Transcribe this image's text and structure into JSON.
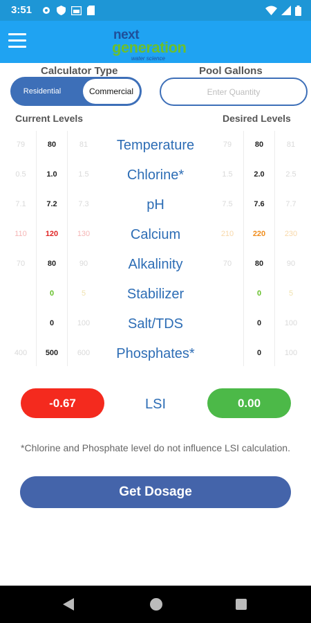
{
  "status": {
    "time": "3:51"
  },
  "logo": {
    "line1": "next",
    "line2": "generation",
    "line3": "water science"
  },
  "calculator": {
    "label": "Calculator Type",
    "options": [
      "Residential",
      "Commercial"
    ],
    "selected": "Commercial"
  },
  "gallons": {
    "label": "Pool Gallons",
    "placeholder": "Enter Quantity",
    "value": ""
  },
  "levels": {
    "current_label": "Current Levels",
    "desired_label": "Desired Levels",
    "rows": [
      {
        "param": "Temperature",
        "current": [
          "79",
          "80",
          "81"
        ],
        "desired": [
          "79",
          "80",
          "81"
        ]
      },
      {
        "param": "Chlorine*",
        "current": [
          "0.5",
          "1.0",
          "1.5"
        ],
        "desired": [
          "1.5",
          "2.0",
          "2.5"
        ]
      },
      {
        "param": "pH",
        "current": [
          "7.1",
          "7.2",
          "7.3"
        ],
        "desired": [
          "7.5",
          "7.6",
          "7.7"
        ]
      },
      {
        "param": "Calcium",
        "current": [
          "110",
          "120",
          "130"
        ],
        "desired": [
          "210",
          "220",
          "230"
        ]
      },
      {
        "param": "Alkalinity",
        "current": [
          "70",
          "80",
          "90"
        ],
        "desired": [
          "70",
          "80",
          "90"
        ]
      },
      {
        "param": "Stabilizer",
        "current": [
          "",
          "0",
          "5"
        ],
        "desired": [
          "",
          "0",
          "5"
        ]
      },
      {
        "param": "Salt/TDS",
        "current": [
          "",
          "0",
          "100"
        ],
        "desired": [
          "",
          "0",
          "100"
        ]
      },
      {
        "param": "Phosphates*",
        "current": [
          "400",
          "500",
          "600"
        ],
        "desired": [
          "",
          "0",
          "100"
        ]
      }
    ]
  },
  "lsi": {
    "label": "LSI",
    "current": "-0.67",
    "desired": "0.00",
    "current_color": "#f42a1e",
    "desired_color": "#4cb948"
  },
  "note": "*Chlorine and Phosphate level do not influence LSI calculation.",
  "button": {
    "label": "Get Dosage"
  },
  "colors": {
    "status_bar": "#1e96d6",
    "app_bar": "#1fa3f2",
    "accent": "#3d6fb8",
    "param_text": "#2d6db5"
  }
}
